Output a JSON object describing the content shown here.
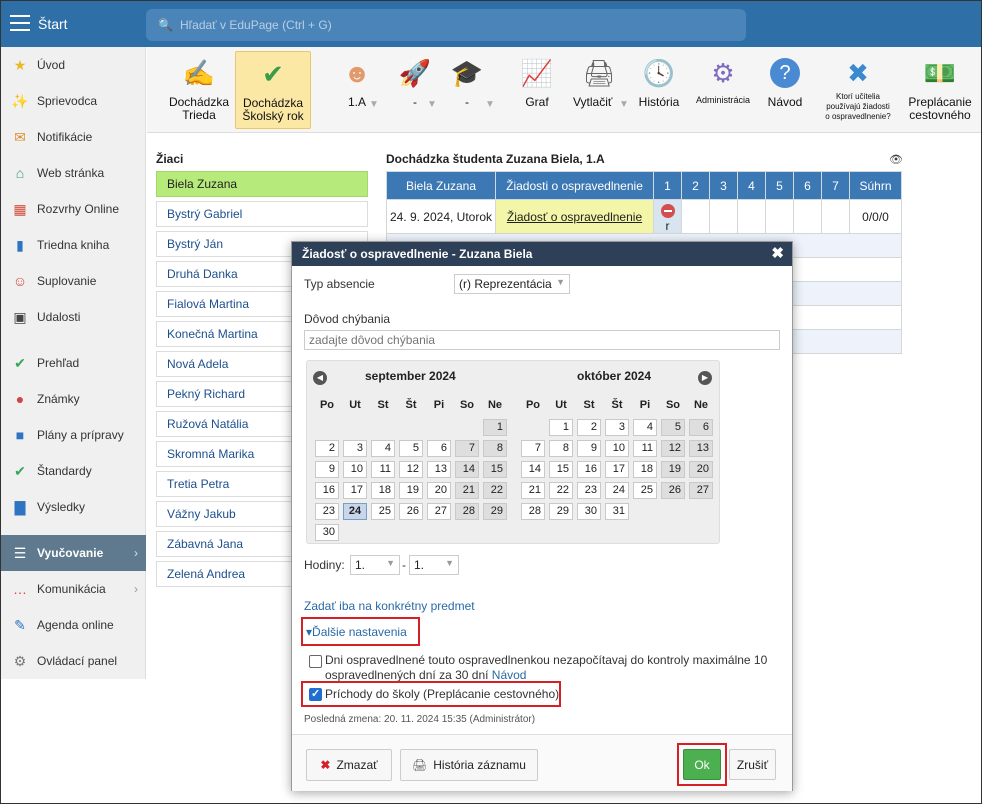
{
  "topbar": {
    "start_label": "Štart",
    "search_placeholder": "Hľadať v EduPage (Ctrl + G)"
  },
  "sidebar": {
    "items": [
      {
        "label": "Úvod",
        "icon": "star-icon",
        "color": "#e9b825"
      },
      {
        "label": "Sprievodca",
        "icon": "magic-wand-icon",
        "color": "#d14b3a"
      },
      {
        "label": "Notifikácie",
        "icon": "envelope-icon",
        "color": "#e08b2a"
      },
      {
        "label": "Web stránka",
        "icon": "house-icon",
        "color": "#3a9b6d"
      },
      {
        "label": "Rozvrhy Online",
        "icon": "calendar-grid-icon",
        "color": "#d1503a"
      },
      {
        "label": "Triedna kniha",
        "icon": "book-icon",
        "color": "#2f74c0"
      },
      {
        "label": "Suplovanie",
        "icon": "person-icon",
        "color": "#d24a3a"
      },
      {
        "label": "Udalosti",
        "icon": "calendar-icon",
        "color": "#444"
      },
      {
        "label": "Prehľad",
        "icon": "check-circle-icon",
        "color": "#3aa55a"
      },
      {
        "label": "Známky",
        "icon": "grade-icon",
        "color": "#d04545"
      },
      {
        "label": "Plány a prípravy",
        "icon": "briefcase-icon",
        "color": "#2f74c0"
      },
      {
        "label": "Štandardy",
        "icon": "shield-check-icon",
        "color": "#3aa55a"
      },
      {
        "label": "Výsledky",
        "icon": "bar-chart-icon",
        "color": "#2f74c0"
      },
      {
        "label": "Vyučovanie",
        "icon": "open-book-icon",
        "color": "#fff",
        "active": true
      },
      {
        "label": "Komunikácia",
        "icon": "chat-icon",
        "color": "#d14b3a"
      },
      {
        "label": "Agenda online",
        "icon": "pen-icon",
        "color": "#2f74c0"
      },
      {
        "label": "Ovládací panel",
        "icon": "gear-icon",
        "color": "#777"
      }
    ]
  },
  "toolbar": {
    "dochadzka_trieda": [
      "Dochádzka",
      "Trieda"
    ],
    "dochadzka_rok": [
      "Dochádzka",
      "Školský rok"
    ],
    "class_select": "1.A",
    "select2": "-",
    "select3": "-",
    "graf": "Graf",
    "vytlacit": "Vytlačiť",
    "historia": "História",
    "administracia": "Administrácia",
    "navod": "Návod",
    "ktori": [
      "Ktorí učitelia",
      "používajú žiadosti",
      "o ospravedlnenie?"
    ],
    "preplacanie": [
      "Preplácanie",
      "cestovného"
    ]
  },
  "students": {
    "title": "Žiaci",
    "list": [
      "Biela Zuzana",
      "Bystrý Gabriel",
      "Bystrý Ján",
      "Druhá Danka",
      "Fialová Martina",
      "Konečná Martina",
      "Nová Adela",
      "Pekný Richard",
      "Ružová Natália",
      "Skromná Marika",
      "Tretia Petra",
      "Vážny Jakub",
      "Zábavná Jana",
      "Zelená Andrea"
    ]
  },
  "attendance": {
    "title": "Dochádzka študenta Zuzana Biela, 1.A",
    "headers": [
      "Biela Zuzana",
      "Žiadosti o ospravedlnenie",
      "1",
      "2",
      "3",
      "4",
      "5",
      "6",
      "7",
      "Súhrn"
    ],
    "row_date": "24. 9. 2024, Utorok",
    "row_request": "Žiadosť o ospravedlnenie",
    "row_mark": "r",
    "row_summary": "0/0/0"
  },
  "dialog": {
    "title": "Žiadosť o ospravedlnenie - Zuzana Biela",
    "type_label": "Typ absencie",
    "type_value": "(r) Reprezentácia",
    "reason_label": "Dôvod chýbania",
    "reason_placeholder": "zadajte dôvod chýbania",
    "cal1_title": "september 2024",
    "cal2_title": "október 2024",
    "dow": [
      "Po",
      "Ut",
      "St",
      "Št",
      "Pi",
      "So",
      "Ne"
    ],
    "hours_label": "Hodiny:",
    "hours_from": "1.",
    "hours_dash": "-",
    "hours_to": "1.",
    "subject_link": "Zadať iba na konkrétny predmet",
    "more_settings": "▾Ďalšie nastavenia",
    "days_check_text": "Dni ospravedlnené touto ospravedlnenkou nezapočítavaj do kontroly maximálne 10 ospravedlnených dní za 30 dní",
    "days_check_link": "Návod",
    "arrivals_check": "Príchody do školy (Preplácanie cestovného)",
    "last_change": "Posledná zmena: 20. 11. 2024 15:35 (Administrátor)",
    "delete_btn": "Zmazať",
    "history_btn": "História záznamu",
    "ok_btn": "Ok",
    "cancel_btn": "Zrušiť"
  },
  "colors": {
    "topbar": "#2f6fa8",
    "selected_student": "#b6ea7b",
    "table_header": "#3c78b4",
    "dialog_header": "#2d4057",
    "highlight_red": "#d42027",
    "ok_green": "#4caf50"
  }
}
